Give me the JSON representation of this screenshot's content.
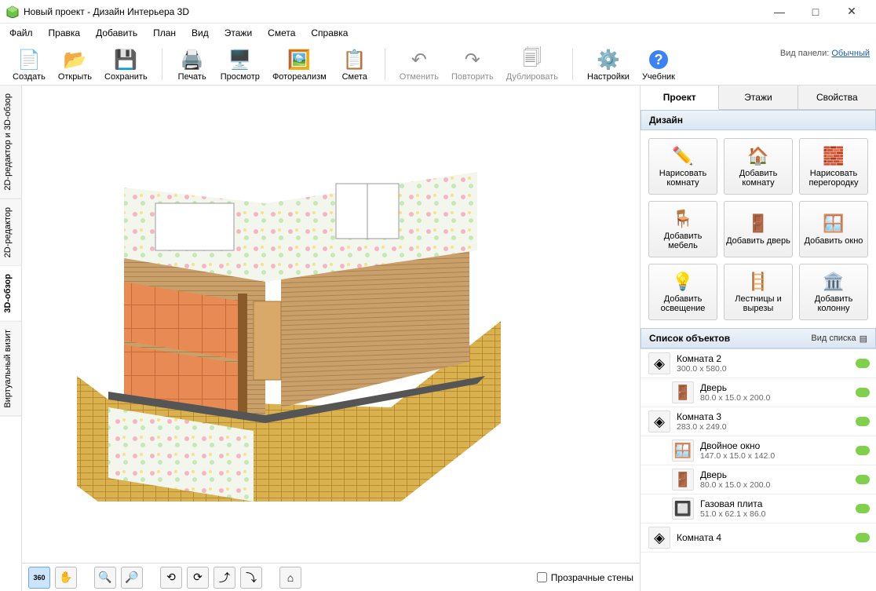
{
  "window": {
    "title": "Новый проект - Дизайн Интерьера 3D"
  },
  "menu": [
    "Файл",
    "Правка",
    "Добавить",
    "План",
    "Вид",
    "Этажи",
    "Смета",
    "Справка"
  ],
  "toolbar": {
    "create": "Создать",
    "open": "Открыть",
    "save": "Сохранить",
    "print": "Печать",
    "preview": "Просмотр",
    "photoreal": "Фотореализм",
    "estimate": "Смета",
    "undo": "Отменить",
    "redo": "Повторить",
    "duplicate": "Дублировать",
    "settings": "Настройки",
    "manual": "Учебник",
    "panel_label": "Вид панели:",
    "panel_mode": "Обычный"
  },
  "left_tabs": {
    "t1": "2D-редактор и 3D-обзор",
    "t2": "2D-редактор",
    "t3": "3D-обзор",
    "t4": "Виртуальный визит"
  },
  "bottombar": {
    "transparent_walls": "Прозрачные стены"
  },
  "side_tabs": {
    "project": "Проект",
    "floors": "Этажи",
    "props": "Свойства"
  },
  "design": {
    "header": "Дизайн",
    "draw_room": "Нарисовать комнату",
    "add_room": "Добавить комнату",
    "draw_wall": "Нарисовать перегородку",
    "add_furn": "Добавить мебель",
    "add_door": "Добавить дверь",
    "add_window": "Добавить окно",
    "add_light": "Добавить освещение",
    "stairs": "Лестницы и вырезы",
    "add_column": "Добавить колонну"
  },
  "objects": {
    "header": "Список объектов",
    "list_view": "Вид списка",
    "items": [
      {
        "name": "Комната 2",
        "dims": "300.0 x 580.0",
        "child": false,
        "icon": "room"
      },
      {
        "name": "Дверь",
        "dims": "80.0 x 15.0 x 200.0",
        "child": true,
        "icon": "door"
      },
      {
        "name": "Комната 3",
        "dims": "283.0 x 249.0",
        "child": false,
        "icon": "room"
      },
      {
        "name": "Двойное окно",
        "dims": "147.0 x 15.0 x 142.0",
        "child": true,
        "icon": "window"
      },
      {
        "name": "Дверь",
        "dims": "80.0 x 15.0 x 200.0",
        "child": true,
        "icon": "door"
      },
      {
        "name": "Газовая плита",
        "dims": "51.0 x 62.1 x 86.0",
        "child": true,
        "icon": "stove"
      },
      {
        "name": "Комната 4",
        "dims": "",
        "child": false,
        "icon": "room"
      }
    ]
  }
}
